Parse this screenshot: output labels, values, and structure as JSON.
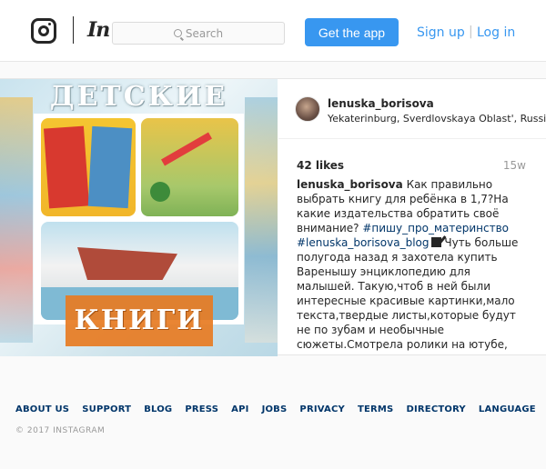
{
  "header": {
    "search_placeholder": "Search",
    "get_app_label": "Get the app",
    "signup_label": "Sign up",
    "separator": "|",
    "login_label": "Log in"
  },
  "post": {
    "image": {
      "title_top": "ДЕТСКИЕ",
      "title_bottom": "КНИГИ"
    },
    "username": "lenuska_borisova",
    "location": "Yekaterinburg, Sverdlovskaya Oblast', Russia",
    "likes": "42 likes",
    "time_ago": "15w",
    "caption": {
      "username": "lenuska_borisova",
      "text1": "Как правильно выбрать книгу для ребёнка в 1,7?На какие издательства обратить своё внимание?",
      "hashtag1": "#пишу_про_материнство",
      "hashtag2": "#lenuska_borisova_blog",
      "text2": "Чуть больше полугода назад я захотела купить Варенышу энциклопедию для малышей. Такую,чтоб в ней были интересные красивые картинки,мало текста,твердые листы,которые будут не по зубам и необычные сюжеты.Смотрела ролики на ютубе, читала разные отзывы и никак не могла сделать выбор.Вопрос отпал сам"
    }
  },
  "footer": {
    "links": [
      "ABOUT US",
      "SUPPORT",
      "BLOG",
      "PRESS",
      "API",
      "JOBS",
      "PRIVACY",
      "TERMS",
      "DIRECTORY",
      "LANGUAGE"
    ],
    "copyright": "© 2017 INSTAGRAM"
  },
  "colors": {
    "accent": "#3897f0",
    "link_dark": "#003569",
    "banner": "#e77b22"
  }
}
